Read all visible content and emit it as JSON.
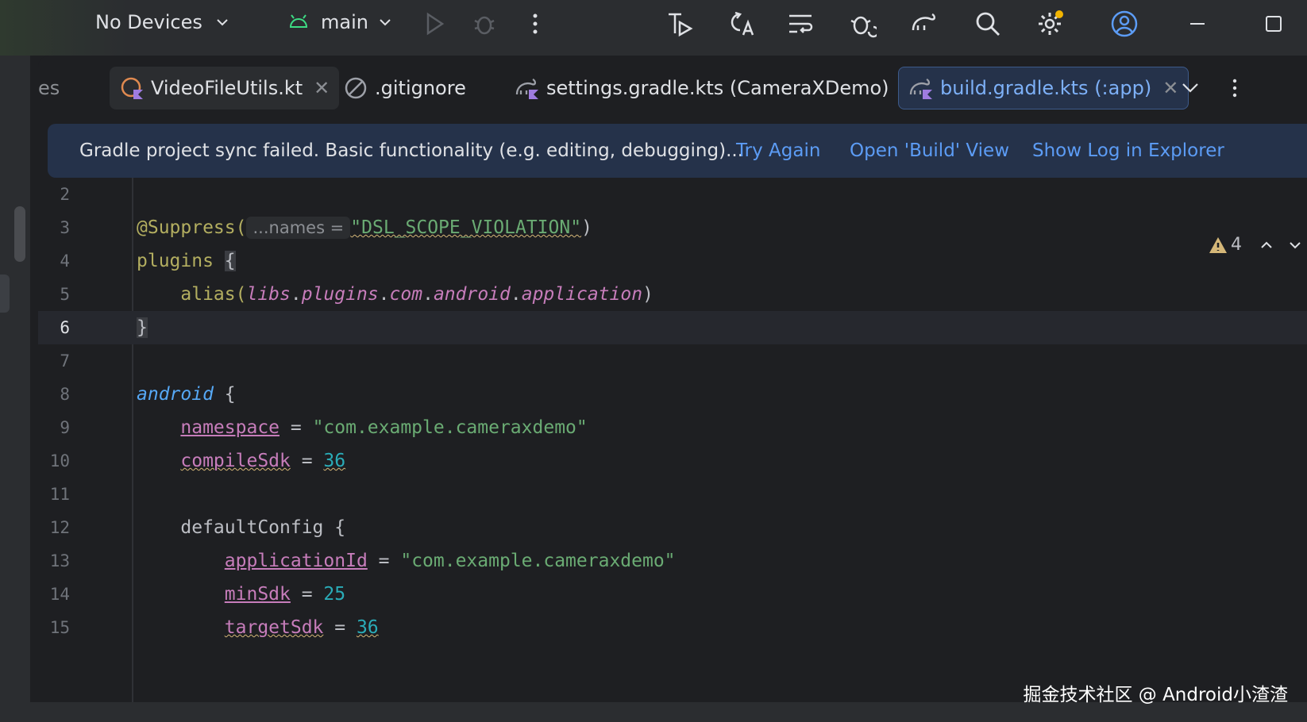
{
  "toolbar": {
    "devices_label": "No Devices",
    "branch_label": "main"
  },
  "tabs": [
    {
      "label": "es"
    },
    {
      "label": "VideoFileUtils.kt"
    },
    {
      "label": ".gitignore"
    },
    {
      "label": "settings.gradle.kts (CameraXDemo)"
    },
    {
      "label": "build.gradle.kts (:app)"
    }
  ],
  "banner": {
    "message": "Gradle project sync failed. Basic functionality (e.g. editing, debugging)...",
    "try_again": "Try Again",
    "open_build": "Open 'Build' View",
    "show_log": "Show Log in Explorer"
  },
  "inspections": {
    "warnings": "4"
  },
  "code": {
    "line_numbers": [
      "2",
      "3",
      "4",
      "5",
      "6",
      "7",
      "8",
      "9",
      "10",
      "11",
      "12",
      "13",
      "14",
      "15"
    ],
    "l3_annotation": "@Suppress(",
    "l3_hint": "...names =",
    "l3_string": "\"DSL_SCOPE_VIOLATION\"",
    "l3_close": ")",
    "l4_kw": "plugins",
    "l4_brace": "{",
    "l5_fn": "alias(",
    "l5_libs": "libs",
    "l5_plugins": "plugins",
    "l5_com": "com",
    "l5_android": "android",
    "l5_application": "application",
    "l5_close": ")",
    "l6": "}",
    "l8_kw": "android",
    "l8_brace": "{",
    "l9_prop": "namespace",
    "l9_eq": " = ",
    "l9_str": "\"com.example.cameraxdemo\"",
    "l10_prop": "compileSdk",
    "l10_eq": " = ",
    "l10_num": "36",
    "l12": "defaultConfig {",
    "l13_prop": "applicationId",
    "l13_eq": " = ",
    "l13_str": "\"com.example.cameraxdemo\"",
    "l14_prop": "minSdk",
    "l14_eq": " = ",
    "l14_num": "25",
    "l15_prop": "targetSdk",
    "l15_eq": " = ",
    "l15_num": "36"
  },
  "watermark": "掘金技术社区 @ Android小渣渣",
  "colors": {
    "accent": "#5c9cf5",
    "banner_bg": "#25324a",
    "bg": "#1e1f22"
  }
}
